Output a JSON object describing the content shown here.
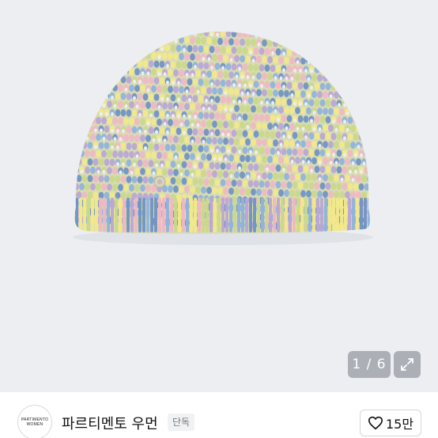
{
  "gallery": {
    "counter": "1 / 6"
  },
  "seller": {
    "avatar_line1": "PARTIMENTO",
    "avatar_line2": "WOMEN",
    "name": "파르티멘토 우먼",
    "tag": "단독"
  },
  "like": {
    "count": "15만"
  },
  "colors": {
    "photo_bg": "#eceef1",
    "yarn": [
      "#f2e98a",
      "#8fb3dc",
      "#f0b7c4",
      "#c9d98a",
      "#b9a6d6",
      "#6f93c4"
    ]
  },
  "icons": {
    "expand": "expand-arrows-icon",
    "like": "heart-outline-icon"
  }
}
